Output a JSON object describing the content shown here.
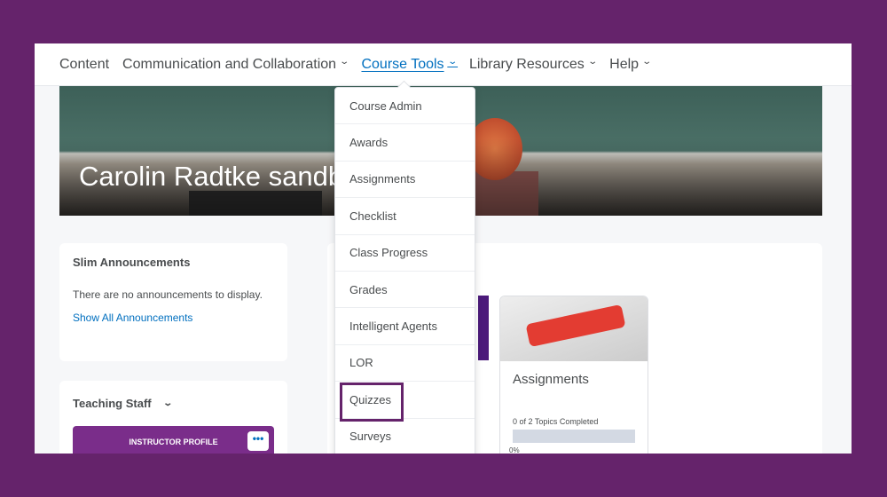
{
  "nav": {
    "items": [
      {
        "label": "Content",
        "dropdown": false
      },
      {
        "label": "Communication and Collaboration",
        "dropdown": true
      },
      {
        "label": "Course Tools",
        "dropdown": true,
        "active": true
      },
      {
        "label": "Library Resources",
        "dropdown": true
      },
      {
        "label": "Help",
        "dropdown": true
      }
    ]
  },
  "banner": {
    "title": "Carolin Radtke sandbox"
  },
  "dropdown": {
    "items": [
      "Course Admin",
      "Awards",
      "Assignments",
      "Checklist",
      "Class Progress",
      "Grades",
      "Intelligent Agents",
      "LOR",
      "Quizzes",
      "Surveys"
    ],
    "highlighted": "Quizzes"
  },
  "announcements": {
    "title": "Slim Announcements",
    "empty": "There are no announcements to display.",
    "link": "Show All Announcements"
  },
  "staff": {
    "title": "Teaching Staff",
    "profile": "INSTRUCTOR PROFILE",
    "more": "•••"
  },
  "tile": {
    "title": "Assignments",
    "progress_text": "0 of 2 Topics Completed",
    "percent": "0%",
    "progress": 0
  },
  "colors": {
    "frame": "#65236b",
    "link": "#006fbf",
    "profile": "#7a2d8a"
  }
}
